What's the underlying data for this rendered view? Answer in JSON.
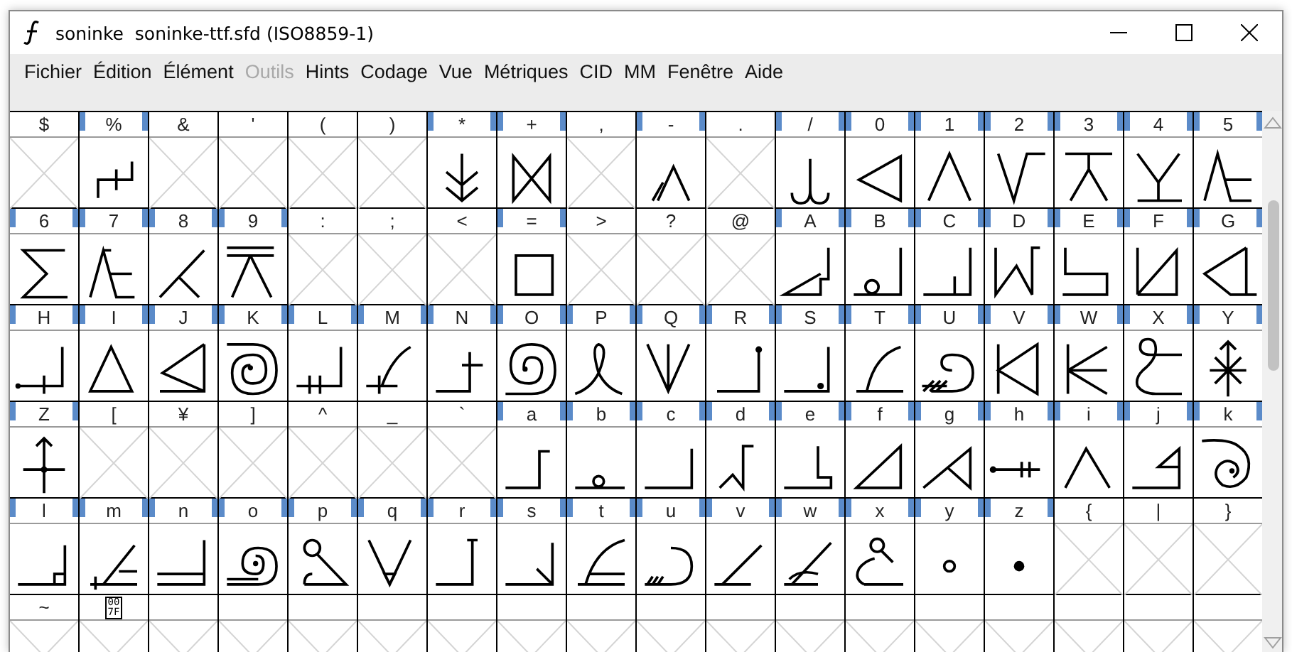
{
  "window": {
    "title": "soninke  soninke-ttf.sfd (ISO8859-1)"
  },
  "menu": [
    {
      "label": "Fichier",
      "disabled": false
    },
    {
      "label": "Édition",
      "disabled": false
    },
    {
      "label": "Élément",
      "disabled": false
    },
    {
      "label": "Outils",
      "disabled": true
    },
    {
      "label": "Hints",
      "disabled": false
    },
    {
      "label": "Codage",
      "disabled": false
    },
    {
      "label": "Vue",
      "disabled": false
    },
    {
      "label": "Métriques",
      "disabled": false
    },
    {
      "label": "CID",
      "disabled": false
    },
    {
      "label": "MM",
      "disabled": false
    },
    {
      "label": "Fenêtre",
      "disabled": false
    },
    {
      "label": "Aide",
      "disabled": false
    }
  ],
  "grid": {
    "rows": [
      {
        "cells": [
          {
            "label": "$",
            "defined": false
          },
          {
            "label": "%",
            "defined": true
          },
          {
            "label": "&",
            "defined": false
          },
          {
            "label": "'",
            "defined": false
          },
          {
            "label": "(",
            "defined": false
          },
          {
            "label": ")",
            "defined": false
          },
          {
            "label": "*",
            "defined": true
          },
          {
            "label": "+",
            "defined": true
          },
          {
            "label": ",",
            "defined": false
          },
          {
            "label": "-",
            "defined": true
          },
          {
            "label": ".",
            "defined": false
          },
          {
            "label": "/",
            "defined": true
          },
          {
            "label": "0",
            "defined": true
          },
          {
            "label": "1",
            "defined": true
          },
          {
            "label": "2",
            "defined": true
          },
          {
            "label": "3",
            "defined": true
          },
          {
            "label": "4",
            "defined": true
          },
          {
            "label": "5",
            "defined": true
          }
        ]
      },
      {
        "cells": [
          {
            "label": "6",
            "defined": true
          },
          {
            "label": "7",
            "defined": true
          },
          {
            "label": "8",
            "defined": true
          },
          {
            "label": "9",
            "defined": true
          },
          {
            "label": ":",
            "defined": false
          },
          {
            "label": ";",
            "defined": false
          },
          {
            "label": "<",
            "defined": false
          },
          {
            "label": "=",
            "defined": true
          },
          {
            "label": ">",
            "defined": false
          },
          {
            "label": "?",
            "defined": false
          },
          {
            "label": "@",
            "defined": false
          },
          {
            "label": "A",
            "defined": true
          },
          {
            "label": "B",
            "defined": true
          },
          {
            "label": "C",
            "defined": true
          },
          {
            "label": "D",
            "defined": true
          },
          {
            "label": "E",
            "defined": true
          },
          {
            "label": "F",
            "defined": true
          },
          {
            "label": "G",
            "defined": true
          }
        ]
      },
      {
        "cells": [
          {
            "label": "H",
            "defined": true
          },
          {
            "label": "I",
            "defined": true
          },
          {
            "label": "J",
            "defined": true
          },
          {
            "label": "K",
            "defined": true
          },
          {
            "label": "L",
            "defined": true
          },
          {
            "label": "M",
            "defined": true
          },
          {
            "label": "N",
            "defined": true
          },
          {
            "label": "O",
            "defined": true
          },
          {
            "label": "P",
            "defined": true
          },
          {
            "label": "Q",
            "defined": true
          },
          {
            "label": "R",
            "defined": true
          },
          {
            "label": "S",
            "defined": true
          },
          {
            "label": "T",
            "defined": true
          },
          {
            "label": "U",
            "defined": true
          },
          {
            "label": "V",
            "defined": true
          },
          {
            "label": "W",
            "defined": true
          },
          {
            "label": "X",
            "defined": true
          },
          {
            "label": "Y",
            "defined": true
          }
        ]
      },
      {
        "cells": [
          {
            "label": "Z",
            "defined": true
          },
          {
            "label": "[",
            "defined": false
          },
          {
            "label": "¥",
            "defined": false
          },
          {
            "label": "]",
            "defined": false
          },
          {
            "label": "^",
            "defined": false
          },
          {
            "label": "_",
            "defined": false
          },
          {
            "label": "`",
            "defined": false
          },
          {
            "label": "a",
            "defined": true
          },
          {
            "label": "b",
            "defined": true
          },
          {
            "label": "c",
            "defined": true
          },
          {
            "label": "d",
            "defined": true
          },
          {
            "label": "e",
            "defined": true
          },
          {
            "label": "f",
            "defined": true
          },
          {
            "label": "g",
            "defined": true
          },
          {
            "label": "h",
            "defined": true
          },
          {
            "label": "i",
            "defined": true
          },
          {
            "label": "j",
            "defined": true
          },
          {
            "label": "k",
            "defined": true
          }
        ]
      },
      {
        "cells": [
          {
            "label": "l",
            "defined": true
          },
          {
            "label": "m",
            "defined": true
          },
          {
            "label": "n",
            "defined": true
          },
          {
            "label": "o",
            "defined": true
          },
          {
            "label": "p",
            "defined": true
          },
          {
            "label": "q",
            "defined": true
          },
          {
            "label": "r",
            "defined": true
          },
          {
            "label": "s",
            "defined": true
          },
          {
            "label": "t",
            "defined": true
          },
          {
            "label": "u",
            "defined": true
          },
          {
            "label": "v",
            "defined": true
          },
          {
            "label": "w",
            "defined": true
          },
          {
            "label": "x",
            "defined": true
          },
          {
            "label": "y",
            "defined": true
          },
          {
            "label": "z",
            "defined": true
          },
          {
            "label": "{",
            "defined": false
          },
          {
            "label": "|",
            "defined": false
          },
          {
            "label": "}",
            "defined": false
          }
        ]
      },
      {
        "cells": [
          {
            "label": "~",
            "defined": false
          },
          {
            "hex_label": "007F",
            "defined": false
          },
          {
            "defined": false
          },
          {
            "defined": false
          },
          {
            "defined": false
          },
          {
            "defined": false
          },
          {
            "defined": false
          },
          {
            "defined": false
          },
          {
            "defined": false
          },
          {
            "defined": false
          },
          {
            "defined": false
          },
          {
            "defined": false
          },
          {
            "defined": false
          },
          {
            "defined": false
          },
          {
            "defined": false
          },
          {
            "defined": false
          },
          {
            "defined": false
          },
          {
            "defined": false
          }
        ]
      }
    ]
  }
}
